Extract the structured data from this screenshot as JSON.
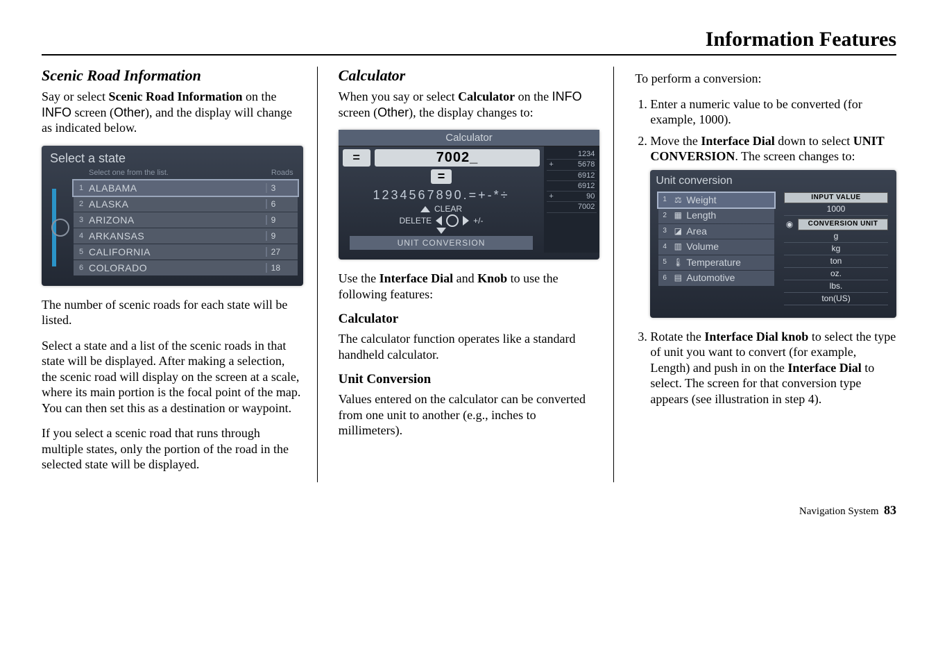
{
  "header": "Information Features",
  "col1": {
    "heading": "Scenic Road Information",
    "intro_pre": "Say or select ",
    "intro_b": "Scenic Road Information",
    "intro_mid": " on the ",
    "intro_info": "INFO",
    "intro_mid2": " screen (",
    "intro_other": "Other",
    "intro_end": "), and the display will change as indicated below.",
    "scr_title": "Select a state",
    "scr_col1": "Select one from the list.",
    "scr_col2": "Roads",
    "states": [
      {
        "n": "1",
        "name": "ALABAMA",
        "cnt": "3"
      },
      {
        "n": "2",
        "name": "ALASKA",
        "cnt": "6"
      },
      {
        "n": "3",
        "name": "ARIZONA",
        "cnt": "9"
      },
      {
        "n": "4",
        "name": "ARKANSAS",
        "cnt": "9"
      },
      {
        "n": "5",
        "name": "CALIFORNIA",
        "cnt": "27"
      },
      {
        "n": "6",
        "name": "COLORADO",
        "cnt": "18"
      }
    ],
    "p1": "The number of scenic roads for each state will be listed.",
    "p2": "Select a state and a list of the scenic roads in that state will be displayed. After making a selection, the scenic road will display on the screen at a scale, where its main portion is the focal point of the map. You can then set this as a destination or waypoint.",
    "p3": "If you select a scenic road that runs through multiple states, only the portion of the road in the selected state will be displayed."
  },
  "col2": {
    "heading": "Calculator",
    "intro_pre": "When you say or select ",
    "intro_b": "Calculator",
    "intro_mid": " on the ",
    "intro_info": "INFO",
    "intro_mid2": " screen (",
    "intro_other": "Other",
    "intro_end": "), the display changes to:",
    "scr_title": "Calculator",
    "display": "7002_",
    "eq": "=",
    "keys": "1234567890.=+-*÷",
    "clear": "CLEAR",
    "delete": "DELETE",
    "plusminus": "+/-",
    "unitconv": "UNIT CONVERSION",
    "tape": [
      {
        "op": "",
        "v": "1234"
      },
      {
        "op": "+",
        "v": "5678"
      },
      {
        "op": "",
        "v": "6912"
      },
      {
        "op": "",
        "v": "6912"
      },
      {
        "op": "+",
        "v": "90"
      },
      {
        "op": "",
        "v": "7002"
      }
    ],
    "p1_pre": "Use the ",
    "p1_b1": "Interface Dial",
    "p1_and": " and ",
    "p1_b2": "Knob",
    "p1_end": " to use the following features:",
    "sub1": "Calculator",
    "sub1_p": "The calculator function operates like a standard handheld calculator.",
    "sub2": "Unit Conversion",
    "sub2_p": "Values entered on the calculator can be converted from one unit to another (e.g., inches to millimeters)."
  },
  "col3": {
    "lead": "To perform a conversion:",
    "li1": "Enter a numeric value to be converted (for example, 1000).",
    "li2_pre": "Move the ",
    "li2_b1": "Interface Dial",
    "li2_mid": " down to select ",
    "li2_b2": "UNIT CONVERSION",
    "li2_end": ". The screen changes to:",
    "scr_title": "Unit conversion",
    "cats": [
      {
        "n": "1",
        "name": "Weight",
        "icon": "⚖"
      },
      {
        "n": "2",
        "name": "Length",
        "icon": "▦"
      },
      {
        "n": "3",
        "name": "Area",
        "icon": "◪"
      },
      {
        "n": "4",
        "name": "Volume",
        "icon": "▥"
      },
      {
        "n": "5",
        "name": "Temperature",
        "icon": "🌡"
      },
      {
        "n": "6",
        "name": "Automotive",
        "icon": "▤"
      }
    ],
    "input_label": "INPUT VALUE",
    "input_value": "1000",
    "conv_label": "CONVERSION UNIT",
    "units": [
      "g",
      "kg",
      "ton",
      "oz.",
      "lbs.",
      "ton(US)"
    ],
    "li3_pre": "Rotate the ",
    "li3_b1": "Interface Dial knob",
    "li3_mid": " to select the type of unit you want to convert (for example, Length) and push in on the ",
    "li3_b2": "Interface Dial",
    "li3_end": " to select. The screen for that conversion type appears (see illustration in step 4)."
  },
  "footer_label": "Navigation System",
  "footer_page": "83"
}
